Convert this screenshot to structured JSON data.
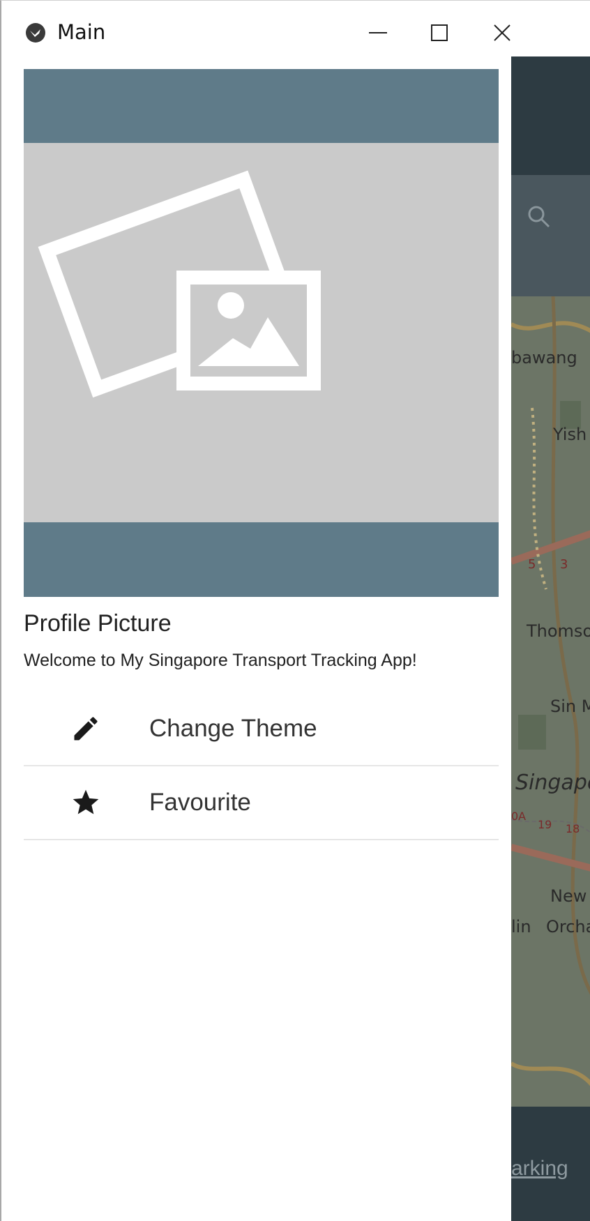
{
  "window": {
    "title": "Main",
    "controls": [
      "minimize",
      "maximize",
      "close"
    ]
  },
  "drawer": {
    "header_image": "image-placeholder-icon",
    "profile_title": "Profile Picture",
    "welcome_text": "Welcome to My Singapore Transport Tracking App!",
    "menu_items": [
      {
        "label": "Change Theme",
        "icon": "pencil-icon"
      },
      {
        "label": "Favourite",
        "icon": "star-icon"
      }
    ]
  },
  "background_app": {
    "search_icon": "search-icon",
    "map_labels": [
      "bawang",
      "Yish",
      "5",
      "3",
      "Thomso",
      "Sin M",
      "Singapo",
      "0A",
      "19",
      "18",
      "New",
      "lin",
      "Orcha"
    ],
    "bottom_link": "arking"
  },
  "colors": {
    "header_band": "#5f7b89",
    "placeholder": "#cacaca",
    "toolbar_dark": "#2d3b42"
  }
}
